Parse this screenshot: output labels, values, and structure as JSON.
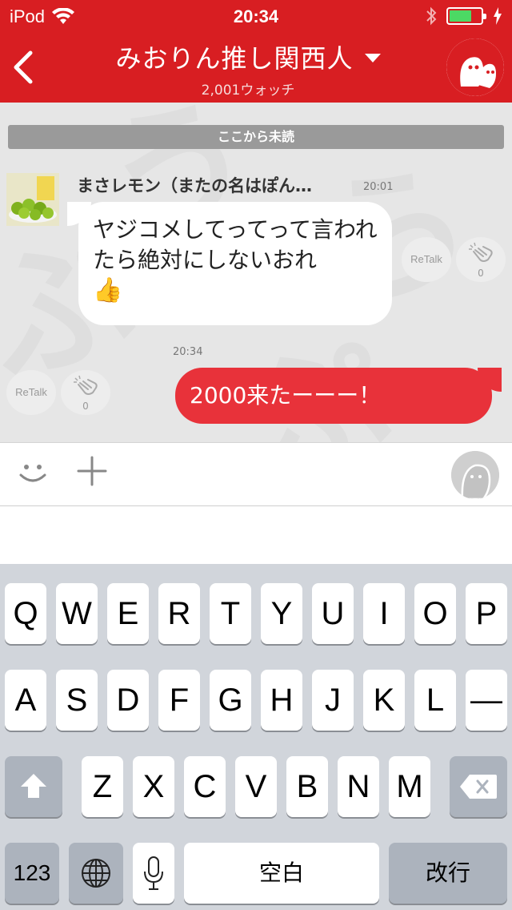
{
  "status_bar": {
    "carrier": "iPod",
    "time": "20:34",
    "battery_color": "#4cd964"
  },
  "header": {
    "back_icon": "chevron-left-icon",
    "title": "みおりん推し関西人",
    "subtitle": "2,001ウォッチ",
    "accent_color": "#d81e22"
  },
  "chat": {
    "unread_divider": "ここから未読",
    "messages": [
      {
        "sender": "まさレモン（またの名はぽん…",
        "time": "20:01",
        "text": "ヤジコメしてってって言われたら絶対にしないおれ",
        "emoji": "👍",
        "retalk_label": "ReTalk",
        "clap_count": "0"
      },
      {
        "time": "20:34",
        "text": "2000来たーーー！",
        "retalk_label": "ReTalk",
        "clap_count": "0",
        "bubble_color": "#e8323a"
      }
    ]
  },
  "input_bar": {
    "emoji_icon": "smiley-icon",
    "plus_icon": "plus-icon",
    "avatar_icon": "default-avatar-icon"
  },
  "keyboard": {
    "row1": [
      "Q",
      "W",
      "E",
      "R",
      "T",
      "Y",
      "U",
      "I",
      "O",
      "P"
    ],
    "row2": [
      "A",
      "S",
      "D",
      "F",
      "G",
      "H",
      "J",
      "K",
      "L",
      "—"
    ],
    "row3": [
      "Z",
      "X",
      "C",
      "V",
      "B",
      "N",
      "M"
    ],
    "numbers_label": "123",
    "space_label": "空白",
    "return_label": "改行"
  }
}
